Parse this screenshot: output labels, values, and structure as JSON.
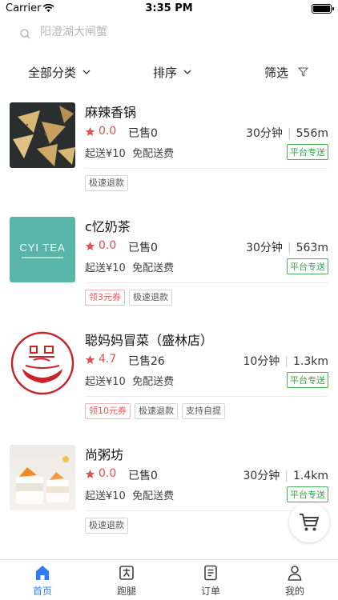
{
  "status_bar": {
    "carrier": "Carrier",
    "time": "3:35 PM"
  },
  "search": {
    "placeholder": "阳澄湖大闸蟹"
  },
  "filters": {
    "category": "全部分类",
    "sort": "排序",
    "filter": "筛选"
  },
  "stores": [
    {
      "name": "麻辣香锅",
      "rating": "0.0",
      "sold": "已售0",
      "time": "30分钟",
      "distance": "556m",
      "delivery_terms": "起送¥10  免配送费",
      "badge": "平台专送",
      "tags": [
        "极速退款"
      ],
      "coupon_tags": []
    },
    {
      "name": "c忆奶茶",
      "logo_text": "CYI TEA",
      "rating": "0.0",
      "sold": "已售0",
      "time": "30分钟",
      "distance": "563m",
      "delivery_terms": "起送¥10  免配送费",
      "badge": "平台专送",
      "tags": [
        "领3元券",
        "极速退款"
      ],
      "coupon_tags": [
        "领3元券"
      ]
    },
    {
      "name": "聪妈妈冒菜（盛林店）",
      "rating": "4.7",
      "sold": "已售26",
      "time": "10分钟",
      "distance": "1.3km",
      "delivery_terms": "起送¥10  免配送费",
      "badge": "平台专送",
      "tags": [
        "领10元券",
        "极速退款",
        "支持自提"
      ],
      "coupon_tags": [
        "领10元券"
      ]
    },
    {
      "name": "尚粥坊",
      "rating": "0.0",
      "sold": "已售0",
      "time": "30分钟",
      "distance": "1.4km",
      "delivery_terms": "起送¥10  免配送费",
      "badge": "平台专送",
      "tags": [
        "极速退款"
      ],
      "coupon_tags": []
    }
  ],
  "tab_bar": [
    {
      "label": "首页",
      "icon": "home-icon",
      "active": true
    },
    {
      "label": "跑腿",
      "icon": "errand-icon",
      "active": false
    },
    {
      "label": "订单",
      "icon": "order-icon",
      "active": false
    },
    {
      "label": "我的",
      "icon": "profile-icon",
      "active": false
    }
  ],
  "colors": {
    "accent": "#2f7df6",
    "rating": "#e0504d",
    "badge_green": "#3aa34a",
    "coupon_red": "#e35b5b"
  }
}
